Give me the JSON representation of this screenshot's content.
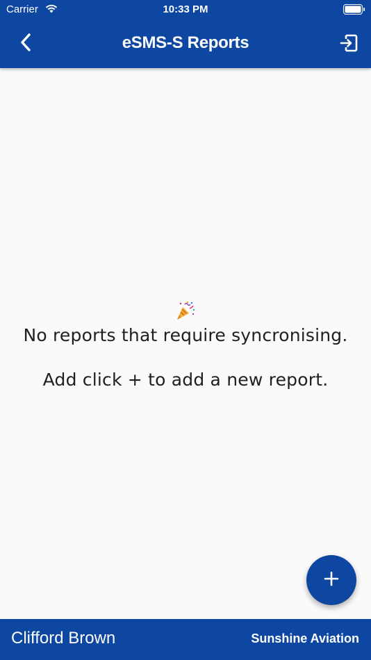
{
  "status_bar": {
    "carrier": "Carrier",
    "time": "10:33 PM"
  },
  "nav": {
    "title": "eSMS-S Reports",
    "back_icon": "chevron-left-icon",
    "exit_icon": "exit-icon"
  },
  "empty_state": {
    "emoji": "party-popper-icon",
    "line1": "No reports that require syncronising.",
    "line2": "Add click + to add a new report."
  },
  "fab": {
    "icon": "plus-icon"
  },
  "footer": {
    "user_name": "Clifford Brown",
    "organization": "Sunshine Aviation"
  },
  "colors": {
    "primary": "#0d47a1",
    "background": "#fafafa",
    "text": "#1f1f1f",
    "on_primary": "#ffffff"
  }
}
